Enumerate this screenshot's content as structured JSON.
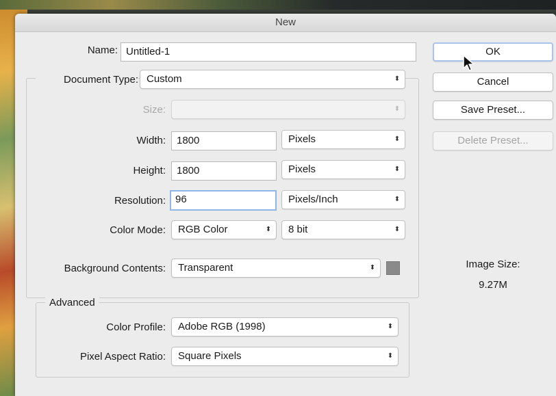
{
  "dialog": {
    "title": "New",
    "name_label": "Name:",
    "name_value": "Untitled-1",
    "doc_type_label": "Document Type:",
    "doc_type_value": "Custom",
    "size_label": "Size:",
    "size_value": "",
    "width_label": "Width:",
    "width_value": "1800",
    "width_unit": "Pixels",
    "height_label": "Height:",
    "height_value": "1800",
    "height_unit": "Pixels",
    "resolution_label": "Resolution:",
    "resolution_value": "96",
    "resolution_unit": "Pixels/Inch",
    "color_mode_label": "Color Mode:",
    "color_mode_value": "RGB Color",
    "bit_depth_value": "8 bit",
    "bg_contents_label": "Background Contents:",
    "bg_contents_value": "Transparent",
    "bg_swatch_color": "#8a8a8a",
    "advanced_label": "Advanced",
    "color_profile_label": "Color Profile:",
    "color_profile_value": "Adobe RGB (1998)",
    "pixel_aspect_label": "Pixel Aspect Ratio:",
    "pixel_aspect_value": "Square Pixels"
  },
  "buttons": {
    "ok": "OK",
    "cancel": "Cancel",
    "save_preset": "Save Preset...",
    "delete_preset": "Delete Preset..."
  },
  "image_size": {
    "label": "Image Size:",
    "value": "9.27M"
  },
  "icons": {
    "select_arrows": "updown-chevron-icon",
    "cursor": "mouse-pointer-icon"
  }
}
